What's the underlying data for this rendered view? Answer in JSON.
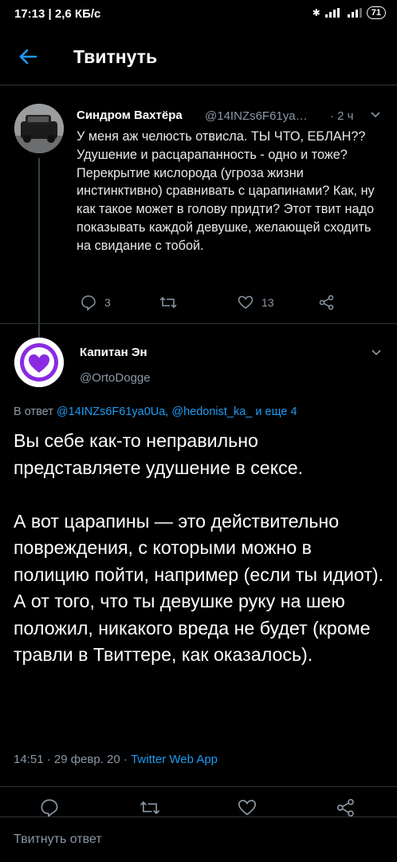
{
  "status_bar": {
    "left_text": "17:13 | 2,6 КБ/с",
    "battery": "71"
  },
  "header": {
    "title": "Твитнуть",
    "back_icon": "arrow-left-icon"
  },
  "parent_tweet": {
    "name": "Синдром Вахтёра",
    "handle": "@14INZs6F61ya…",
    "time": "· 2 ч",
    "text": "У меня аж челюсть отвисла. ТЫ ЧТО, ЕБЛАН?? Удушение и расцарапанность - одно и тоже? Перекрытие кислорода (угроза жизни инстинктивно) сравнивать с царапинами? Как, ну как такое может в голову придти? Этот твит надо показывать каждой девушке, желающей сходить на свидание с тобой.",
    "reply_count": "3",
    "like_count": "13"
  },
  "main_tweet": {
    "name": "Капитан Эн",
    "handle": "@OrtoDogge",
    "reply_prefix": "В ответ",
    "reply_mentions": "@14INZs6F61ya0Ua, @hedonist_ka_",
    "reply_suffix": "и еще 4",
    "text": "Вы себе как-то неправильно представляете удушение в сексе.\n\nА вот царапины — это действительно повреждения, с которыми можно в полицию пойти, например (если ты идиот). А от того, что ты девушке руку на шею положил, никакого вреда не будет (кроме травли в Твиттере, как оказалось).",
    "timestamp": "14:51 · 29 февр. 20 ·",
    "app": "Twitter Web App"
  },
  "compose": {
    "placeholder": "Твитнуть ответ"
  },
  "colors": {
    "accent": "#1d9bf0",
    "background": "#000000",
    "muted": "#8b98a5",
    "avatar_purple": "#8a2be2"
  }
}
